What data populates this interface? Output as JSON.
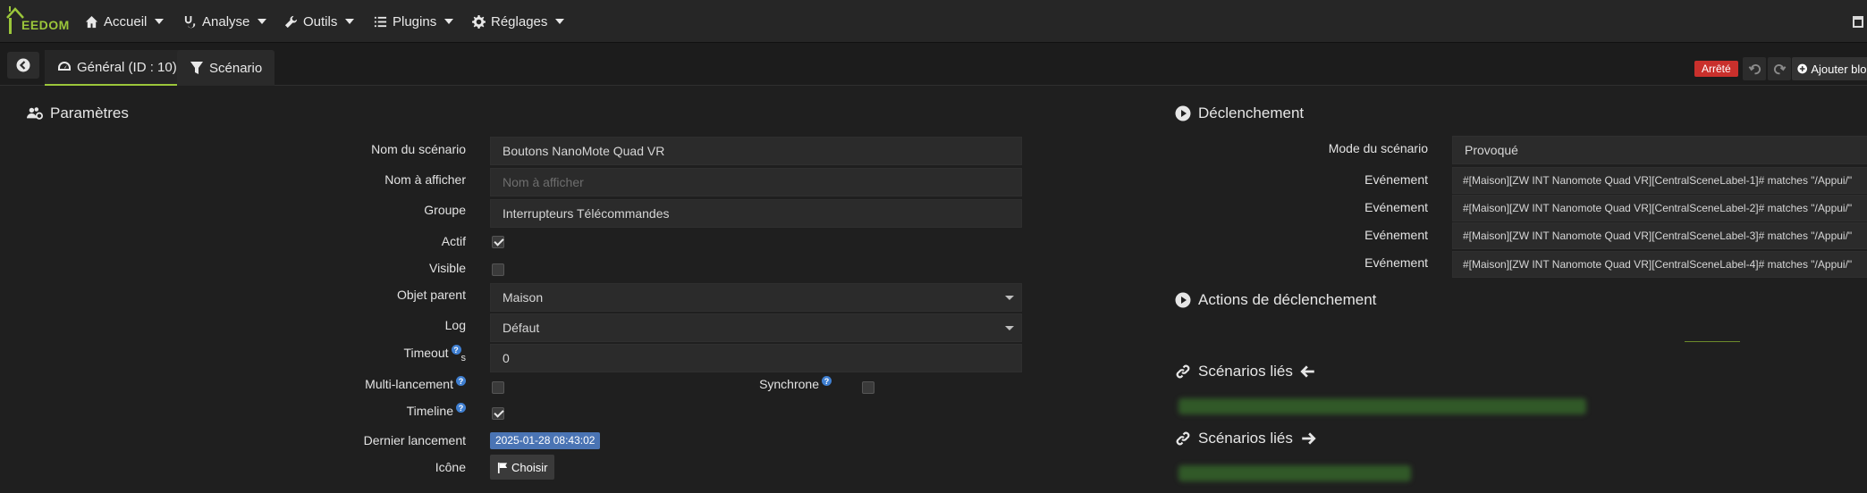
{
  "navbar": {
    "logo_text": "EEDOM",
    "items": [
      {
        "label": "Accueil",
        "icon": "home-icon"
      },
      {
        "label": "Analyse",
        "icon": "stethoscope-icon"
      },
      {
        "label": "Outils",
        "icon": "wrench-icon"
      },
      {
        "label": "Plugins",
        "icon": "list-icon"
      },
      {
        "label": "Réglages",
        "icon": "gear-icon"
      }
    ]
  },
  "tabs": {
    "general": "Général (ID : 10)",
    "scenario": "Scénario"
  },
  "toolbar": {
    "status": "Arrêté",
    "status_color": "#c9302c",
    "add_block": "Ajouter bloc"
  },
  "params": {
    "title": "Paramètres",
    "name_label": "Nom du scénario",
    "name_value": "Boutons NanoMote Quad VR",
    "display_label": "Nom à afficher",
    "display_placeholder": "Nom à afficher",
    "group_label": "Groupe",
    "group_value": "Interrupteurs Télécommandes",
    "active_label": "Actif",
    "active_checked": true,
    "visible_label": "Visible",
    "visible_checked": false,
    "parent_label": "Objet parent",
    "parent_value": "Maison",
    "log_label": "Log",
    "log_value": "Défaut",
    "timeout_label": "Timeout",
    "timeout_unit": "s",
    "timeout_value": "0",
    "multi_label": "Multi-lancement",
    "multi_checked": false,
    "sync_label": "Synchrone",
    "sync_checked": false,
    "timeline_label": "Timeline",
    "timeline_checked": true,
    "last_run_label": "Dernier lancement",
    "last_run_value": "2025-01-28 08:43:02",
    "icon_label": "Icône",
    "choose_label": "Choisir"
  },
  "trigger": {
    "title": "Déclenchement",
    "mode_label": "Mode du scénario",
    "mode_value": "Provoqué",
    "event_label": "Evénement",
    "events": [
      "#[Maison][ZW INT Nanomote Quad VR][CentralSceneLabel-1]# matches \"/Appui/\"",
      "#[Maison][ZW INT Nanomote Quad VR][CentralSceneLabel-2]# matches \"/Appui/\"",
      "#[Maison][ZW INT Nanomote Quad VR][CentralSceneLabel-3]# matches \"/Appui/\"",
      "#[Maison][ZW INT Nanomote Quad VR][CentralSceneLabel-4]# matches \"/Appui/\""
    ]
  },
  "trigger_actions": {
    "title": "Actions de déclenchement"
  },
  "linked_in": {
    "title": "Scénarios liés"
  },
  "linked_out": {
    "title": "Scénarios liés"
  },
  "colors": {
    "accent": "#9bc63a",
    "date_badge": "#4a74b4",
    "help": "#3f7fd1"
  }
}
